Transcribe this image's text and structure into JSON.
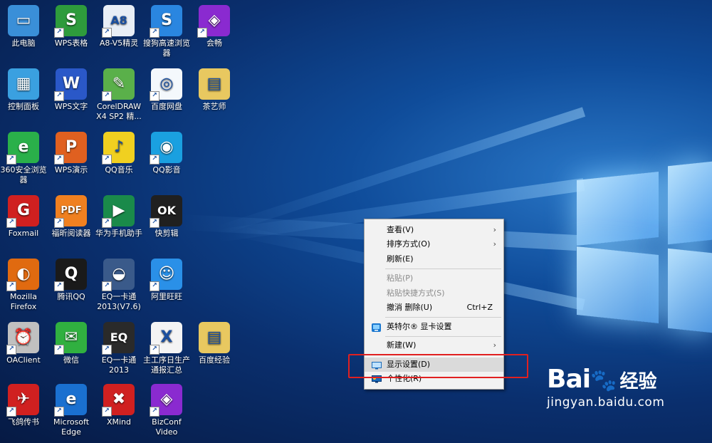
{
  "desktop": {
    "icons": [
      {
        "label": "此电脑",
        "color": "#3a8fd8",
        "glyph": "▭",
        "shortcut": false
      },
      {
        "label": "WPS表格",
        "color": "#2e9b3c",
        "glyph": "S",
        "shortcut": true
      },
      {
        "label": "A8-V5精灵",
        "color": "#e8eef6",
        "glyph": "A8",
        "shortcut": true
      },
      {
        "label": "搜狗高速浏览器",
        "color": "#2a86e0",
        "glyph": "S",
        "shortcut": true
      },
      {
        "label": "会畅",
        "color": "#8a2ad0",
        "glyph": "◈",
        "shortcut": true
      },
      {
        "label": "控制面板",
        "color": "#3aa0e0",
        "glyph": "▦",
        "shortcut": false
      },
      {
        "label": "WPS文字",
        "color": "#2a58c8",
        "glyph": "W",
        "shortcut": true
      },
      {
        "label": "CorelDRAW X4 SP2 精...",
        "color": "#5ab04a",
        "glyph": "✎",
        "shortcut": true
      },
      {
        "label": "百度网盘",
        "color": "#f4f8fc",
        "glyph": "◎",
        "shortcut": true
      },
      {
        "label": "茶艺师",
        "color": "#e8c860",
        "glyph": "▤",
        "shortcut": false
      },
      {
        "label": "360安全浏览器",
        "color": "#2ab04a",
        "glyph": "e",
        "shortcut": true
      },
      {
        "label": "WPS演示",
        "color": "#e06020",
        "glyph": "P",
        "shortcut": true
      },
      {
        "label": "QQ音乐",
        "color": "#f0d020",
        "glyph": "♪",
        "shortcut": true
      },
      {
        "label": "QQ影音",
        "color": "#1aa0e0",
        "glyph": "◉",
        "shortcut": true
      },
      {
        "label": "Foxmail",
        "color": "#d02020",
        "glyph": "G",
        "shortcut": true
      },
      {
        "label": "福昕阅读器",
        "color": "#f08020",
        "glyph": "PDF",
        "shortcut": true
      },
      {
        "label": "华为手机助手",
        "color": "#1a8a4a",
        "glyph": "▶",
        "shortcut": true
      },
      {
        "label": "快剪辑",
        "color": "#202020",
        "glyph": "OK",
        "shortcut": true
      },
      {
        "label": "Mozilla Firefox",
        "color": "#e06a10",
        "glyph": "◐",
        "shortcut": true
      },
      {
        "label": "腾讯QQ",
        "color": "#1a1a1a",
        "glyph": "Q",
        "shortcut": true
      },
      {
        "label": "EQ一卡通 2013(V7.6)",
        "color": "#3a5a8a",
        "glyph": "◒",
        "shortcut": true
      },
      {
        "label": "阿里旺旺",
        "color": "#2a90e8",
        "glyph": "☺",
        "shortcut": true
      },
      {
        "label": "OAClient",
        "color": "#c0c0c0",
        "glyph": "⏰",
        "shortcut": true
      },
      {
        "label": "微信",
        "color": "#30b040",
        "glyph": "✉",
        "shortcut": true
      },
      {
        "label": "EQ一卡通 2013",
        "color": "#2a2a2a",
        "glyph": "EQ",
        "shortcut": true
      },
      {
        "label": "主工序日生产通报汇总",
        "color": "#f4f4f4",
        "glyph": "X",
        "shortcut": true
      },
      {
        "label": "百度经验",
        "color": "#e8c860",
        "glyph": "▤",
        "shortcut": false
      },
      {
        "label": "飞鸽传书",
        "color": "#d02020",
        "glyph": "✈",
        "shortcut": true
      },
      {
        "label": "Microsoft Edge",
        "color": "#1a70d0",
        "glyph": "e",
        "shortcut": true
      },
      {
        "label": "XMind",
        "color": "#d02020",
        "glyph": "✖",
        "shortcut": true
      },
      {
        "label": "BizConf Video",
        "color": "#8a2ad0",
        "glyph": "◈",
        "shortcut": true
      }
    ]
  },
  "context_menu": {
    "items": [
      {
        "label": "查看(V)",
        "submenu": true
      },
      {
        "label": "排序方式(O)",
        "submenu": true
      },
      {
        "label": "刷新(E)"
      },
      {
        "label": "粘贴(P)",
        "disabled": true
      },
      {
        "label": "粘贴快捷方式(S)",
        "disabled": true
      },
      {
        "label": "撤消 删除(U)",
        "shortcut": "Ctrl+Z"
      },
      {
        "label": "英特尔® 显卡设置",
        "icon": "intel-graphics-icon"
      },
      {
        "label": "新建(W)",
        "submenu": true
      },
      {
        "label": "显示设置(D)",
        "icon": "display-settings-icon"
      },
      {
        "label": "个性化(R)",
        "icon": "personalize-icon"
      }
    ]
  },
  "watermark": {
    "brand": "Bai",
    "brand_end": "经验",
    "url": "jingyan.baidu.com"
  },
  "colors": {
    "highlight_box": "#e02020",
    "menu_bg": "#f2f2f2"
  }
}
